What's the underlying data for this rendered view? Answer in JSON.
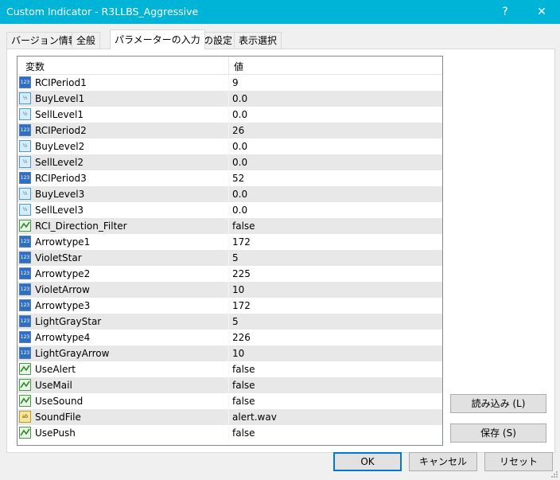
{
  "window": {
    "title": "Custom Indicator - R3LLBS_Aggressive",
    "help_glyph": "?",
    "close_glyph": "✕"
  },
  "tabs": [
    {
      "label": "バージョン情報"
    },
    {
      "label": "全般"
    },
    {
      "label": "パラメーターの入力"
    },
    {
      "label": "色の設定"
    },
    {
      "label": "表示選択"
    }
  ],
  "active_tab": 2,
  "grid": {
    "col_variable": "変数",
    "col_value": "値",
    "rows": [
      {
        "icon": "int-icon",
        "icon_text": "123",
        "name": "RCIPeriod1",
        "value": "9"
      },
      {
        "icon": "double-icon",
        "icon_text": "½",
        "name": "BuyLevel1",
        "value": "0.0"
      },
      {
        "icon": "double-icon",
        "icon_text": "½",
        "name": "SellLevel1",
        "value": "0.0"
      },
      {
        "icon": "int-icon",
        "icon_text": "123",
        "name": "RCIPeriod2",
        "value": "26"
      },
      {
        "icon": "double-icon",
        "icon_text": "½",
        "name": "BuyLevel2",
        "value": "0.0"
      },
      {
        "icon": "double-icon",
        "icon_text": "½",
        "name": "SellLevel2",
        "value": "0.0"
      },
      {
        "icon": "int-icon",
        "icon_text": "123",
        "name": "RCIPeriod3",
        "value": "52"
      },
      {
        "icon": "double-icon",
        "icon_text": "½",
        "name": "BuyLevel3",
        "value": "0.0"
      },
      {
        "icon": "double-icon",
        "icon_text": "½",
        "name": "SellLevel3",
        "value": "0.0"
      },
      {
        "icon": "bool-icon",
        "icon_text": "",
        "name": "RCI_Direction_Filter",
        "value": "false"
      },
      {
        "icon": "int-icon",
        "icon_text": "123",
        "name": "Arrowtype1",
        "value": "172"
      },
      {
        "icon": "int-icon",
        "icon_text": "123",
        "name": "VioletStar",
        "value": "5"
      },
      {
        "icon": "int-icon",
        "icon_text": "123",
        "name": "Arrowtype2",
        "value": "225"
      },
      {
        "icon": "int-icon",
        "icon_text": "123",
        "name": "VioletArrow",
        "value": "10"
      },
      {
        "icon": "int-icon",
        "icon_text": "123",
        "name": "Arrowtype3",
        "value": "172"
      },
      {
        "icon": "int-icon",
        "icon_text": "123",
        "name": "LightGrayStar",
        "value": "5"
      },
      {
        "icon": "int-icon",
        "icon_text": "123",
        "name": "Arrowtype4",
        "value": "226"
      },
      {
        "icon": "int-icon",
        "icon_text": "123",
        "name": "LightGrayArrow",
        "value": "10"
      },
      {
        "icon": "bool-icon",
        "icon_text": "",
        "name": "UseAlert",
        "value": "false"
      },
      {
        "icon": "bool-icon",
        "icon_text": "",
        "name": "UseMail",
        "value": "false"
      },
      {
        "icon": "bool-icon",
        "icon_text": "",
        "name": "UseSound",
        "value": "false"
      },
      {
        "icon": "string-icon",
        "icon_text": "ab",
        "name": "SoundFile",
        "value": "alert.wav"
      },
      {
        "icon": "bool-icon",
        "icon_text": "",
        "name": "UsePush",
        "value": "false"
      }
    ]
  },
  "buttons": {
    "load": "読み込み (L)",
    "save": "保存 (S)",
    "ok": "OK",
    "cancel": "キャンセル",
    "reset": "リセット"
  },
  "colors": {
    "titlebar": "#00b4d8",
    "default_button_border": "#0078d7",
    "alt_row": "#e8e8e8"
  }
}
